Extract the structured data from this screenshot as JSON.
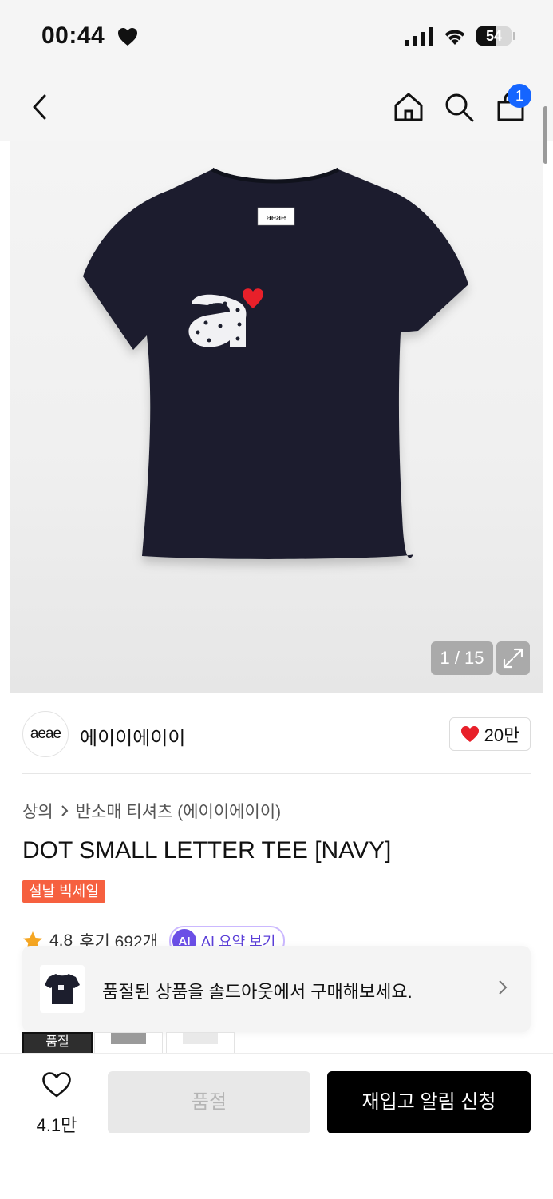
{
  "status_bar": {
    "time": "00:44",
    "battery": "54",
    "battery_level": 0.54
  },
  "nav": {
    "cart_count": "1"
  },
  "gallery": {
    "counter": "1 / 15"
  },
  "brand": {
    "logo_text": "aeae",
    "name": "에이이에이이",
    "like_count": "20만"
  },
  "breadcrumb": {
    "category": "상의",
    "subcategory": "반소매 티셔츠 (에이이에이이)"
  },
  "product": {
    "title": "DOT SMALL LETTER TEE [NAVY]",
    "sale_badge": "설날 빅세일",
    "rating": "4.8",
    "reviews": "후기 692개",
    "ai_badge": "AI",
    "ai_label": "AI 요약 보기"
  },
  "toast": {
    "text": "품절된 상품을 솔드아웃에서 구매해보세요."
  },
  "thumbnails": [
    {
      "label": "품절"
    }
  ],
  "bottom_bar": {
    "wish_count": "4.1만",
    "soldout_label": "품절",
    "restock_label": "재입고 알림 신청"
  },
  "colors": {
    "accent_blue": "#1565ff",
    "sale_red": "#f6603f",
    "heart_red": "#e8202a",
    "navy": "#1c1e2d"
  }
}
